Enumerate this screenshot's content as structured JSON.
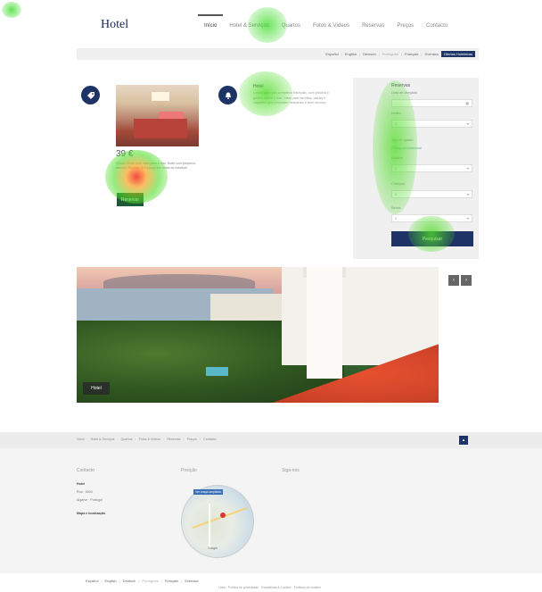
{
  "header": {
    "logo": "Hotel",
    "nav": [
      "Início",
      "Hotel & Serviços",
      "Quartos",
      "Fotos & Vídeos",
      "Reservas",
      "Preços",
      "Contacto"
    ]
  },
  "langbar": {
    "items": [
      "Español",
      "English",
      "Deutsch",
      "Português",
      "Français",
      "Svenska"
    ],
    "current": "Português",
    "button": "Ofertas Hoteleiras"
  },
  "promo": {
    "price": "39 €",
    "text": "Quarto Duplo com vista para o mar. Noite com pequeno-almoço. Reserve já e poupe em todas as estadias.",
    "button": "Reservar"
  },
  "info": {
    "title": "Hotel",
    "text": "Localizado num complexo tranquilo, com piscina e jardins sobre o mar. Ideal para famílias, casais e viajantes que procuram descanso e bom serviço."
  },
  "search": {
    "title": "Reservas",
    "fields": [
      {
        "label": "Data de chegada",
        "value": ""
      },
      {
        "label": "Noites",
        "value": "1"
      },
      {
        "label": "Tipo de quarto",
        "value": ""
      },
      {
        "label": "Adultos",
        "value": "2"
      },
      {
        "label": "Crianças",
        "value": "0"
      },
      {
        "label": "Bebés",
        "value": "0"
      }
    ],
    "promo_link": "Código promocional",
    "button": "Pesquisar"
  },
  "hero": {
    "caption": "Hotel",
    "prev": "‹",
    "next": "›"
  },
  "footer": {
    "breadcrumb": [
      "Início",
      "Hotel & Serviços",
      "Quartos",
      "Fotos & Vídeos",
      "Reservas",
      "Preços",
      "Contacto"
    ],
    "top_button": "▴",
    "contact_title": "Contacto",
    "contact_lines": [
      "Hotel",
      "Rua · 0000",
      "Algarve · Portugal",
      "Mapa e localização"
    ],
    "position_title": "Posição",
    "map_label": "Ver mapa ampliado",
    "map_google": "Google",
    "follow_title": "Siga-nos",
    "bottom_langs": [
      "Español",
      "English",
      "Deutsch",
      "Português",
      "Français",
      "Svenska"
    ],
    "bottom_current": "Português",
    "bottom_links": "Links · Política de privacidade · Estatísticas & Cookies · Políticas de cookies"
  }
}
